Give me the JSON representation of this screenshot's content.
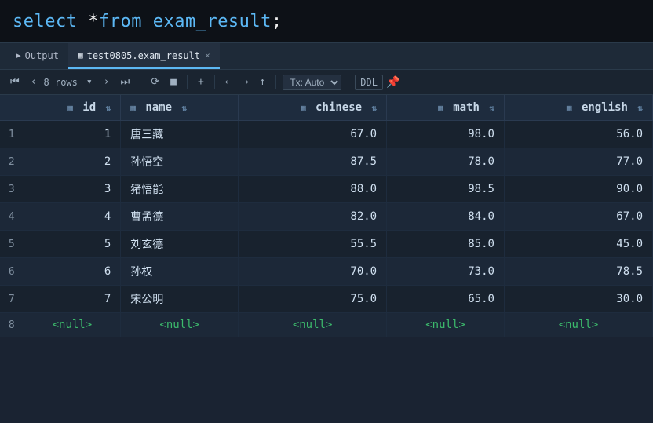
{
  "sql_editor": {
    "code": "select *from exam_result;"
  },
  "tabs": {
    "output_label": "Output",
    "table_tab_label": "test0805.exam_result",
    "close_symbol": "×"
  },
  "toolbar": {
    "nav_first": "⏮",
    "nav_prev": "‹",
    "nav_next": "›",
    "nav_last": "⏭",
    "row_count": "8 rows",
    "row_count_arrow": "▾",
    "refresh_icon": "⟳",
    "stop_icon": "■",
    "add_icon": "+",
    "undo_icon": "←",
    "redo_icon": "→",
    "commit_icon": "↑",
    "tx_label": "Tx: Auto",
    "tx_arrow": "▾",
    "ddl_label": "DDL",
    "pin_icon": "📌"
  },
  "table": {
    "columns": [
      {
        "key": "id",
        "label": "id",
        "type": "num"
      },
      {
        "key": "name",
        "label": "name",
        "type": "text"
      },
      {
        "key": "chinese",
        "label": "chinese",
        "type": "num"
      },
      {
        "key": "math",
        "label": "math",
        "type": "num"
      },
      {
        "key": "english",
        "label": "english",
        "type": "num"
      }
    ],
    "rows": [
      {
        "row_num": 1,
        "id": "1",
        "name": "唐三藏",
        "chinese": "67.0",
        "math": "98.0",
        "english": "56.0"
      },
      {
        "row_num": 2,
        "id": "2",
        "name": "孙悟空",
        "chinese": "87.5",
        "math": "78.0",
        "english": "77.0"
      },
      {
        "row_num": 3,
        "id": "3",
        "name": "猪悟能",
        "chinese": "88.0",
        "math": "98.5",
        "english": "90.0"
      },
      {
        "row_num": 4,
        "id": "4",
        "name": "曹孟德",
        "chinese": "82.0",
        "math": "84.0",
        "english": "67.0"
      },
      {
        "row_num": 5,
        "id": "5",
        "name": "刘玄德",
        "chinese": "55.5",
        "math": "85.0",
        "english": "45.0"
      },
      {
        "row_num": 6,
        "id": "6",
        "name": "孙权",
        "chinese": "70.0",
        "math": "73.0",
        "english": "78.5"
      },
      {
        "row_num": 7,
        "id": "7",
        "name": "宋公明",
        "chinese": "75.0",
        "math": "65.0",
        "english": "30.0"
      },
      {
        "row_num": 8,
        "id": null,
        "name": null,
        "chinese": null,
        "math": null,
        "english": null
      }
    ],
    "null_display": "<null>"
  },
  "colors": {
    "keyword": "#5cb8f5",
    "null_text": "#3cba6c",
    "accent": "#e8a030"
  }
}
